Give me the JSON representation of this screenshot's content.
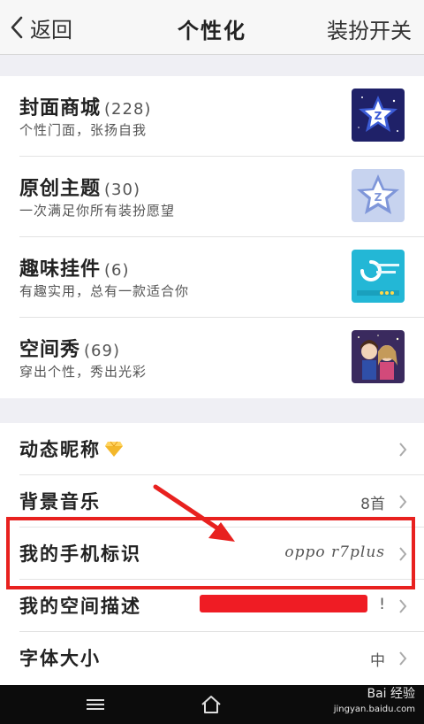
{
  "header": {
    "back_label": "返回",
    "title": "个性化",
    "right_label": "装扮开关"
  },
  "features": [
    {
      "name": "封面商城",
      "count": "(228)",
      "desc": "个性门面，张扬自我",
      "icon": "cover-store-icon"
    },
    {
      "name": "原创主题",
      "count": "(30)",
      "desc": "一次满足你所有装扮愿望",
      "icon": "theme-icon"
    },
    {
      "name": "趣味挂件",
      "count": "(6)",
      "desc": "有趣实用，总有一款适合你",
      "icon": "widget-icon"
    },
    {
      "name": "空间秀",
      "count": "(69)",
      "desc": "穿出个性，秀出光彩",
      "icon": "space-show-icon"
    }
  ],
  "settings": [
    {
      "label": "动态昵称",
      "value": ""
    },
    {
      "label": "背景音乐",
      "value": "8首"
    },
    {
      "label": "我的手机标识",
      "value": "oppo r7plus"
    },
    {
      "label": "我的空间描述",
      "value": "!"
    },
    {
      "label": "字体大小",
      "value": "中"
    }
  ],
  "watermark": {
    "text": "Bai 经验",
    "sub": "jingyan.baidu.com"
  },
  "colors": {
    "accent_red": "#e8211f",
    "icon_blue": "#2c2f8f",
    "gem_yellow": "#f3b72a"
  }
}
